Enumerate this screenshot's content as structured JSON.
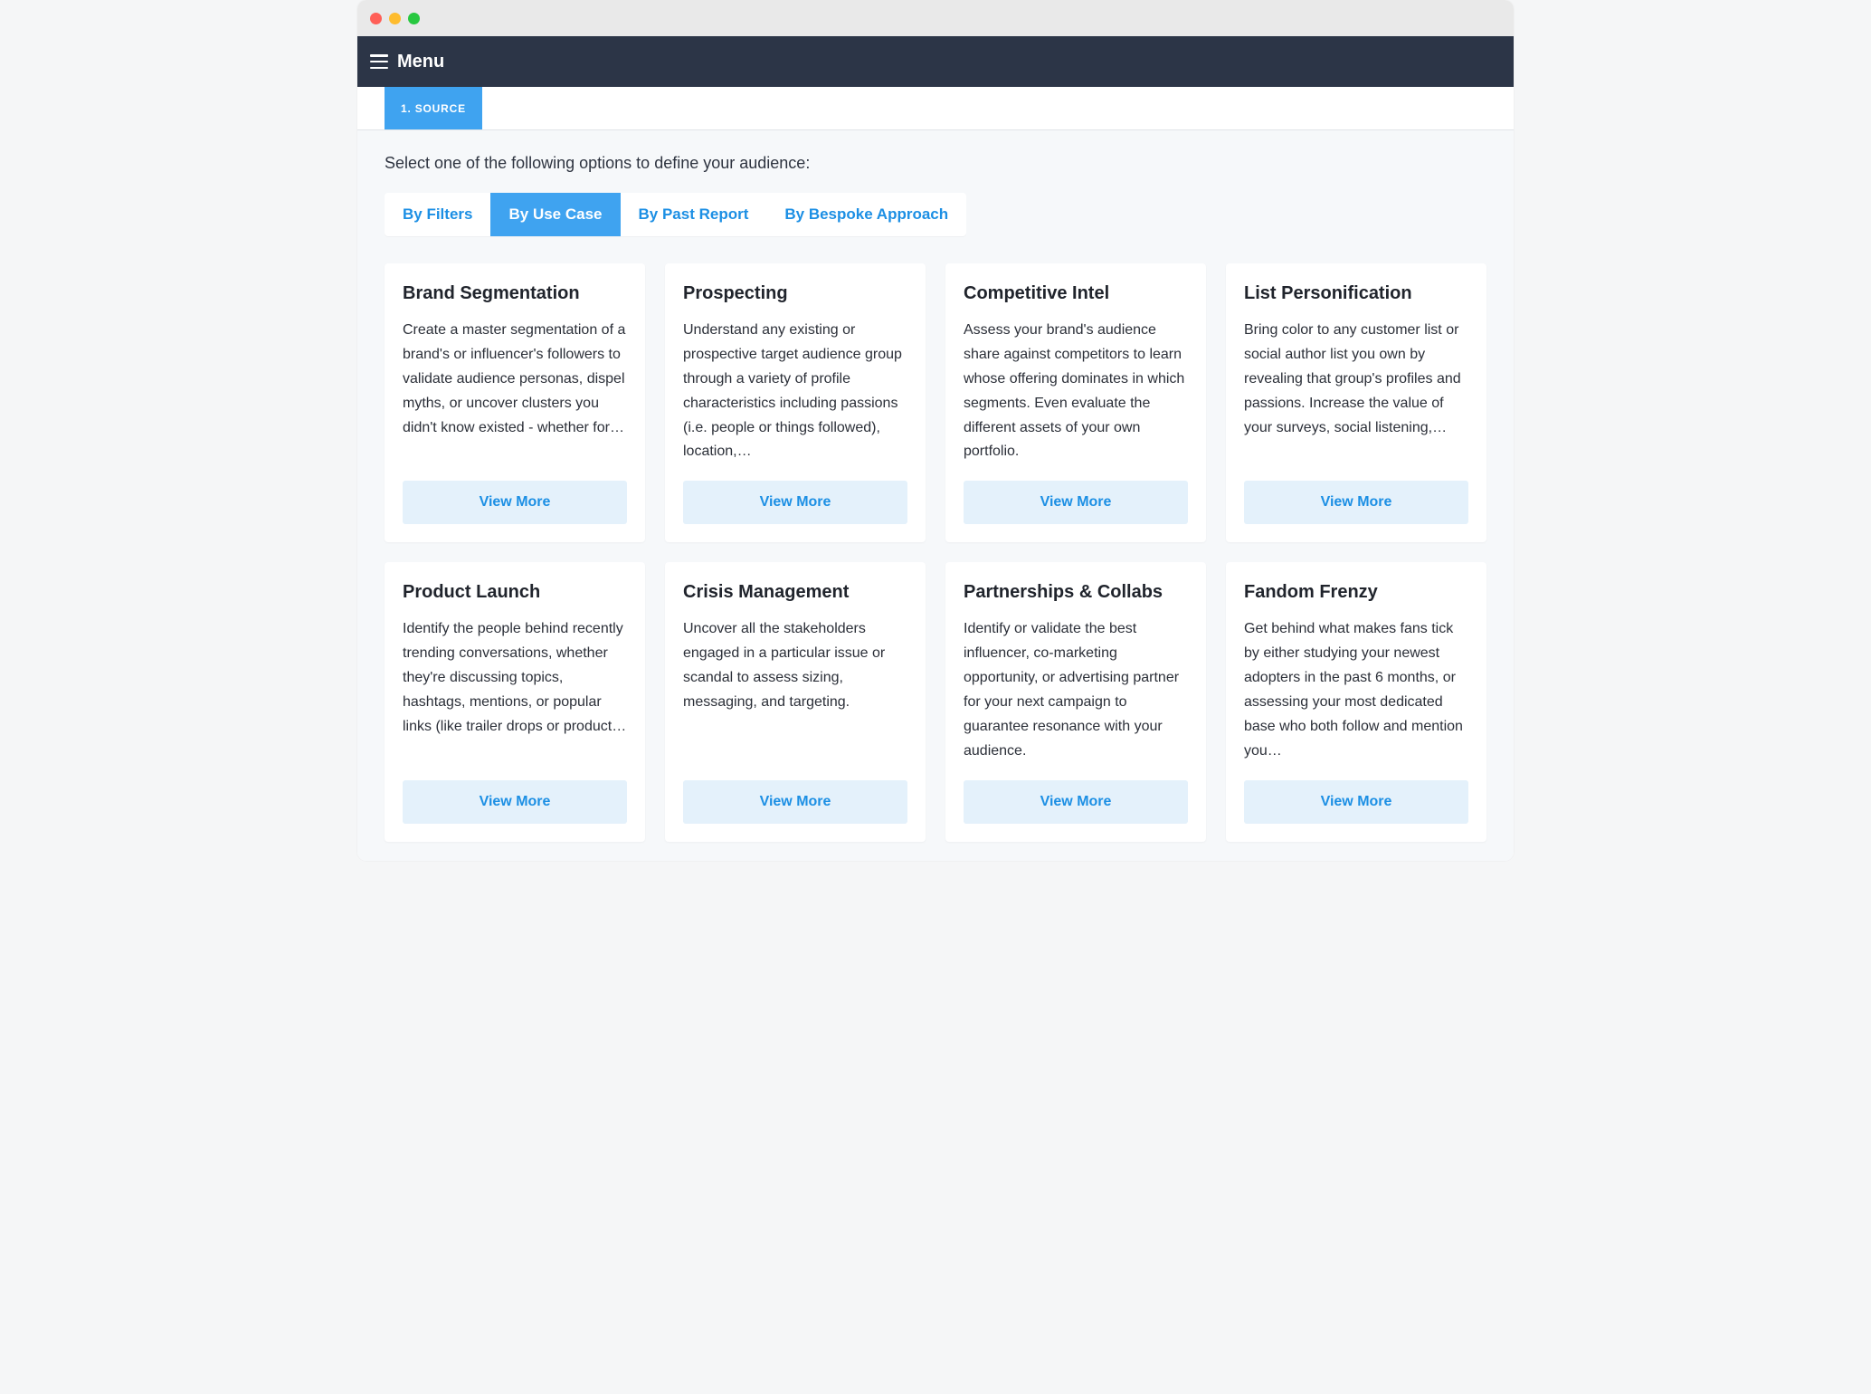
{
  "topnav": {
    "menu_label": "Menu"
  },
  "steps": {
    "active_label": "1. SOURCE"
  },
  "prompt": "Select one of the following options to define your audience:",
  "filter_tabs": [
    {
      "label": "By Filters",
      "active": false
    },
    {
      "label": "By Use Case",
      "active": true
    },
    {
      "label": "By Past Report",
      "active": false
    },
    {
      "label": "By Bespoke Approach",
      "active": false
    }
  ],
  "cards": [
    {
      "title": "Brand Segmentation",
      "desc": "Create a master segmentation of a brand's or influencer's followers to validate audience personas, dispel myths, or uncover clusters you didn't know existed - whether for…",
      "cta": "View More"
    },
    {
      "title": "Prospecting",
      "desc": "Understand any existing or prospective target audience group through a variety of profile characteristics including passions (i.e. people or things followed), location,…",
      "cta": "View More"
    },
    {
      "title": "Competitive Intel",
      "desc": "Assess your brand's audience share against competitors to learn whose offering dominates in which segments. Even evaluate the different assets of your own portfolio.",
      "cta": "View More"
    },
    {
      "title": "List Personification",
      "desc": "Bring color to any customer list or social author list you own by revealing that group's profiles and passions. Increase the value of your surveys, social listening,…",
      "cta": "View More"
    },
    {
      "title": "Product Launch",
      "desc": "Identify the people behind recently trending conversations, whether they're discussing topics, hashtags, mentions, or popular links (like trailer drops or product…",
      "cta": "View More"
    },
    {
      "title": "Crisis Management",
      "desc": "Uncover all the stakeholders engaged in a particular issue or scandal to assess sizing, messaging, and targeting.",
      "cta": "View More"
    },
    {
      "title": "Partnerships & Collabs",
      "desc": "Identify or validate the best influencer, co-marketing opportunity, or advertising partner for your next campaign to guarantee resonance with your audience.",
      "cta": "View More"
    },
    {
      "title": "Fandom Frenzy",
      "desc": "Get behind what makes fans tick by either studying your newest adopters in the past 6 months, or assessing your most dedicated base who both follow and mention you…",
      "cta": "View More"
    }
  ]
}
